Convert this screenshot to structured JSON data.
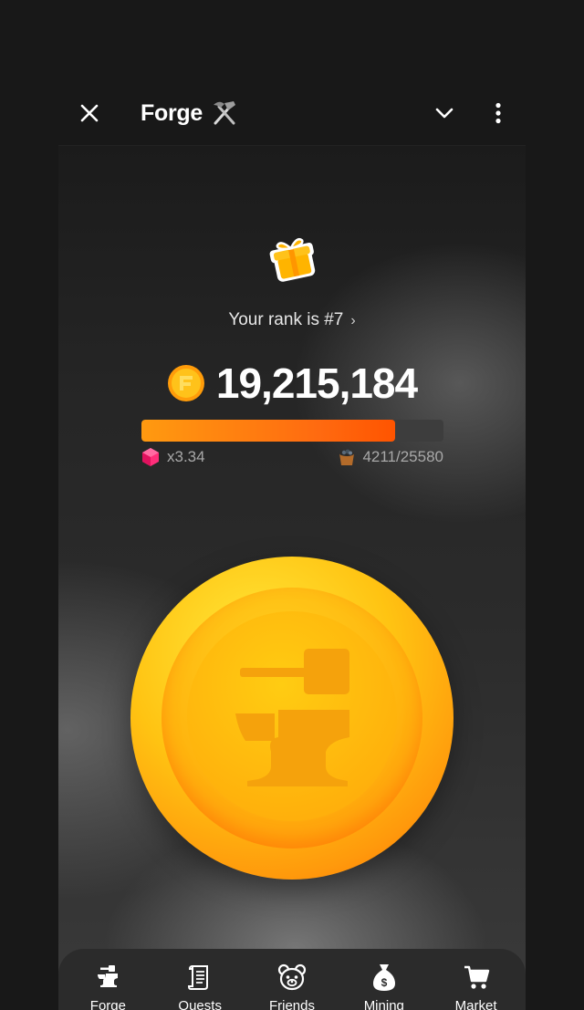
{
  "header": {
    "title": "Forge",
    "title_icon": "hammer-pick-icon",
    "left_icon": "close-icon",
    "right_icons": [
      "chevron-down-icon",
      "more-vertical-icon"
    ]
  },
  "reward": {
    "icon": "gift-icon"
  },
  "rank": {
    "text": "Your rank is #7",
    "chevron": "›"
  },
  "balance": {
    "value": "19,215,184",
    "icon": "coin-icon"
  },
  "progress": {
    "fraction": 0.84,
    "fill_color": "#ff6a10",
    "track_color": "#3d3d3d"
  },
  "stats": {
    "multiplier": {
      "text": "x3.34",
      "icon": "gem-icon"
    },
    "energy": {
      "text": "4211/25580",
      "icon": "energy-bucket-icon"
    }
  },
  "tap_coin": {
    "icon": "anvil-coin-icon"
  },
  "nav": {
    "items": [
      {
        "label": "Forge",
        "icon": "anvil-icon"
      },
      {
        "label": "Quests",
        "icon": "scroll-icon"
      },
      {
        "label": "Friends",
        "icon": "bear-icon"
      },
      {
        "label": "Mining",
        "icon": "money-bag-icon"
      },
      {
        "label": "Market",
        "icon": "cart-icon"
      }
    ]
  },
  "colors": {
    "background": "#181818",
    "accent": "#ff9a10",
    "coin": "#ffc312"
  }
}
